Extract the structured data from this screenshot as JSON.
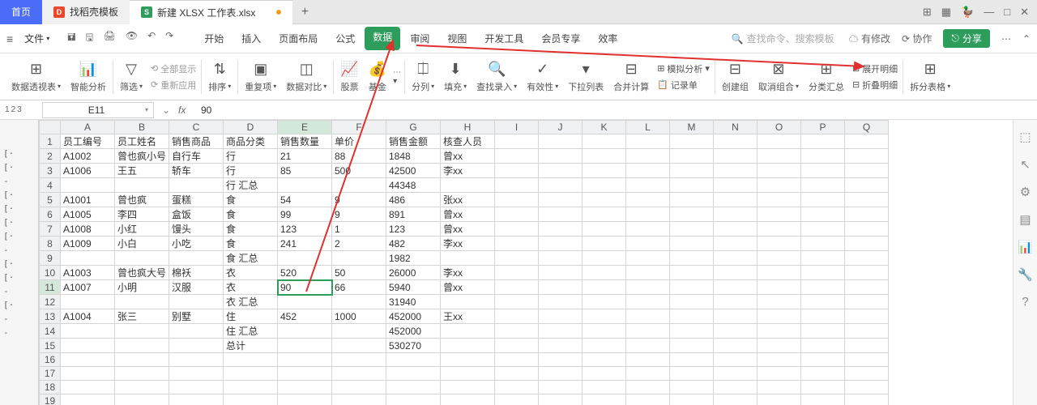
{
  "tabs": {
    "home": "首页",
    "docx": {
      "icon": "D",
      "label": "找稻壳模板"
    },
    "xlsx": {
      "icon": "S",
      "label": "新建 XLSX 工作表.xlsx"
    }
  },
  "menu": {
    "file": "文件",
    "main_tabs": [
      "开始",
      "插入",
      "页面布局",
      "公式",
      "数据",
      "审阅",
      "视图",
      "开发工具",
      "会员专享",
      "效率"
    ],
    "active_tab_index": 4,
    "search_placeholder": "查找命令、搜索模板",
    "changes": "有修改",
    "coop": "协作",
    "share": "分享"
  },
  "ribbon": {
    "pivot": "数据透视表",
    "smart": "智能分析",
    "filter": "筛选",
    "show_all": "全部显示",
    "reapply": "重新应用",
    "sort": "排序",
    "dup": "重复项",
    "compare": "数据对比",
    "stock": "股票",
    "fund": "基金",
    "split_col": "分列",
    "fill": "填充",
    "find_entry": "查找录入",
    "validity": "有效性",
    "dropdown": "下拉列表",
    "consolidate": "合并计算",
    "sim": "模拟分析",
    "record": "记录单",
    "group": "创建组",
    "ungroup": "取消组合",
    "subtotal": "分类汇总",
    "expand": "展开明细",
    "collapse": "折叠明细",
    "split_sheet": "拆分表格"
  },
  "fx": {
    "cell": "E11",
    "value": "90"
  },
  "outline_levels": [
    "1",
    "2",
    "3"
  ],
  "cols": [
    "A",
    "B",
    "C",
    "D",
    "E",
    "F",
    "G",
    "H",
    "I",
    "J",
    "K",
    "L",
    "M",
    "N",
    "O",
    "P",
    "Q"
  ],
  "headers": [
    "员工编号",
    "员工姓名",
    "销售商品",
    "商品分类",
    "销售数量",
    "单价",
    "销售金额",
    "核查人员"
  ],
  "rows": [
    {
      "n": 1,
      "mark": "",
      "cells": [
        "员工编号",
        "员工姓名",
        "销售商品",
        "商品分类",
        "销售数量",
        "单价",
        "销售金额",
        "核查人员"
      ],
      "hdr": true
    },
    {
      "n": 2,
      "mark": "[·",
      "cells": [
        "A1002",
        "曾也疯小号",
        "自行车",
        "行",
        "21",
        "88",
        "1848",
        "曾xx"
      ]
    },
    {
      "n": 3,
      "mark": "[·",
      "cells": [
        "A1006",
        "王五",
        "轿车",
        "行",
        "85",
        "500",
        "42500",
        "李xx"
      ]
    },
    {
      "n": 4,
      "mark": "-",
      "cells": [
        "",
        "",
        "",
        "行 汇总",
        "",
        "",
        "44348",
        ""
      ],
      "bold": true
    },
    {
      "n": 5,
      "mark": "[·",
      "cells": [
        "A1001",
        "曾也疯",
        "蛋糕",
        "食",
        "54",
        "9",
        "486",
        "张xx"
      ]
    },
    {
      "n": 6,
      "mark": "[·",
      "cells": [
        "A1005",
        "李四",
        "盒饭",
        "食",
        "99",
        "9",
        "891",
        "曾xx"
      ]
    },
    {
      "n": 7,
      "mark": "[·",
      "cells": [
        "A1008",
        "小红",
        "馒头",
        "食",
        "123",
        "1",
        "123",
        "曾xx"
      ]
    },
    {
      "n": 8,
      "mark": "[·",
      "cells": [
        "A1009",
        "小白",
        "小吃",
        "食",
        "241",
        "2",
        "482",
        "李xx"
      ]
    },
    {
      "n": 9,
      "mark": "-",
      "cells": [
        "",
        "",
        "",
        "食 汇总",
        "",
        "",
        "1982",
        ""
      ],
      "bold": true
    },
    {
      "n": 10,
      "mark": "[·",
      "cells": [
        "A1003",
        "曾也疯大号",
        "棉袄",
        "衣",
        "520",
        "50",
        "26000",
        "李xx"
      ]
    },
    {
      "n": 11,
      "mark": "[·",
      "cells": [
        "A1007",
        "小明",
        "汉服",
        "衣",
        "90",
        "66",
        "5940",
        "曾xx"
      ],
      "sel": true
    },
    {
      "n": 12,
      "mark": "-",
      "cells": [
        "",
        "",
        "",
        "衣 汇总",
        "",
        "",
        "31940",
        ""
      ],
      "bold": true
    },
    {
      "n": 13,
      "mark": "[·",
      "cells": [
        "A1004",
        "张三",
        "别墅",
        "住",
        "452",
        "1000",
        "452000",
        "王xx"
      ]
    },
    {
      "n": 14,
      "mark": "-",
      "cells": [
        "",
        "",
        "",
        "住 汇总",
        "",
        "",
        "452000",
        ""
      ],
      "bold": true
    },
    {
      "n": 15,
      "mark": "-",
      "cells": [
        "",
        "",
        "",
        "总计",
        "",
        "",
        "530270",
        ""
      ],
      "bold": true
    },
    {
      "n": 16,
      "mark": "",
      "cells": [
        "",
        "",
        "",
        "",
        "",
        "",
        "",
        ""
      ]
    },
    {
      "n": 17,
      "mark": "",
      "cells": [
        "",
        "",
        "",
        "",
        "",
        "",
        "",
        ""
      ]
    },
    {
      "n": 18,
      "mark": "",
      "cells": [
        "",
        "",
        "",
        "",
        "",
        "",
        "",
        ""
      ]
    },
    {
      "n": 19,
      "mark": "",
      "cells": [
        "",
        "",
        "",
        "",
        "",
        "",
        "",
        ""
      ]
    }
  ],
  "numcols": [
    4,
    5,
    6
  ],
  "colors": {
    "accent": "#2e9c5a",
    "tab_home": "#4a6cf7",
    "arrow": "#e03030"
  }
}
